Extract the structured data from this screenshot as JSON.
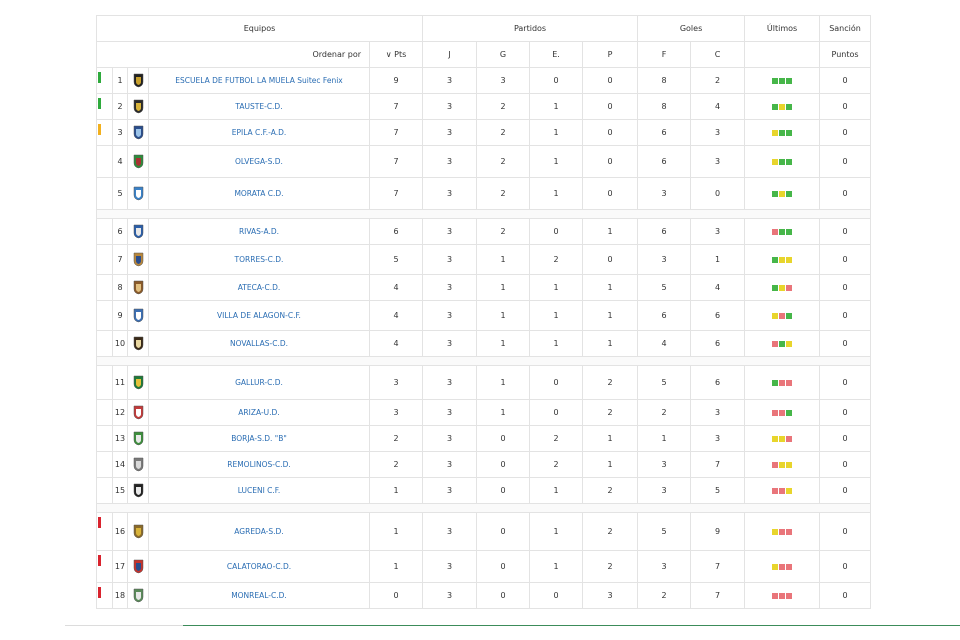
{
  "headers": {
    "equipos": "Equipos",
    "partidos": "Partidos",
    "goles": "Goles",
    "ultimos": "Últimos",
    "sancion": "Sanción",
    "ordenar": "Ordenar por",
    "pts": "Pts",
    "j": "J",
    "g": "G",
    "e": "E.",
    "p": "P",
    "f": "F",
    "c": "C",
    "puntos": "Puntos"
  },
  "colors": {
    "green": "#2eaa3c",
    "yellow": "#f2b01e",
    "red": "#d9232e",
    "win": "#46b649",
    "draw": "#e8d52c",
    "loss": "#e9757a"
  },
  "teams": [
    {
      "pos": "1",
      "name": "ESCUELA DE FUTBOL LA MUELA Suitec Fenix",
      "pts": "9",
      "j": "3",
      "g": "3",
      "e": "0",
      "p": "0",
      "f": "8",
      "c": "2",
      "san": "0",
      "mark": "green",
      "last": [
        "W",
        "W",
        "W"
      ]
    },
    {
      "pos": "2",
      "name": "TAUSTE-C.D.",
      "pts": "7",
      "j": "3",
      "g": "2",
      "e": "1",
      "p": "0",
      "f": "8",
      "c": "4",
      "san": "0",
      "mark": "green",
      "last": [
        "W",
        "D",
        "W"
      ]
    },
    {
      "pos": "3",
      "name": "EPILA C.F.-A.D.",
      "pts": "7",
      "j": "3",
      "g": "2",
      "e": "1",
      "p": "0",
      "f": "6",
      "c": "3",
      "san": "0",
      "mark": "yellow",
      "last": [
        "D",
        "W",
        "W"
      ]
    },
    {
      "pos": "4",
      "name": "OLVEGA-S.D.",
      "pts": "7",
      "j": "3",
      "g": "2",
      "e": "1",
      "p": "0",
      "f": "6",
      "c": "3",
      "san": "0",
      "mark": "",
      "last": [
        "D",
        "W",
        "W"
      ]
    },
    {
      "pos": "5",
      "name": "MORATA C.D.",
      "pts": "7",
      "j": "3",
      "g": "2",
      "e": "1",
      "p": "0",
      "f": "3",
      "c": "0",
      "san": "0",
      "mark": "",
      "last": [
        "W",
        "D",
        "W"
      ]
    },
    {
      "pos": "6",
      "name": "RIVAS-A.D.",
      "pts": "6",
      "j": "3",
      "g": "2",
      "e": "0",
      "p": "1",
      "f": "6",
      "c": "3",
      "san": "0",
      "mark": "",
      "last": [
        "L",
        "W",
        "W"
      ]
    },
    {
      "pos": "7",
      "name": "TORRES-C.D.",
      "pts": "5",
      "j": "3",
      "g": "1",
      "e": "2",
      "p": "0",
      "f": "3",
      "c": "1",
      "san": "0",
      "mark": "",
      "last": [
        "W",
        "D",
        "D"
      ]
    },
    {
      "pos": "8",
      "name": "ATECA-C.D.",
      "pts": "4",
      "j": "3",
      "g": "1",
      "e": "1",
      "p": "1",
      "f": "5",
      "c": "4",
      "san": "0",
      "mark": "",
      "last": [
        "W",
        "D",
        "L"
      ]
    },
    {
      "pos": "9",
      "name": "VILLA DE ALAGON-C.F.",
      "pts": "4",
      "j": "3",
      "g": "1",
      "e": "1",
      "p": "1",
      "f": "6",
      "c": "6",
      "san": "0",
      "mark": "",
      "last": [
        "D",
        "L",
        "W"
      ]
    },
    {
      "pos": "10",
      "name": "NOVALLAS-C.D.",
      "pts": "4",
      "j": "3",
      "g": "1",
      "e": "1",
      "p": "1",
      "f": "4",
      "c": "6",
      "san": "0",
      "mark": "",
      "last": [
        "L",
        "W",
        "D"
      ]
    },
    {
      "pos": "11",
      "name": "GALLUR-C.D.",
      "pts": "3",
      "j": "3",
      "g": "1",
      "e": "0",
      "p": "2",
      "f": "5",
      "c": "6",
      "san": "0",
      "mark": "",
      "last": [
        "W",
        "L",
        "L"
      ]
    },
    {
      "pos": "12",
      "name": "ARIZA-U.D.",
      "pts": "3",
      "j": "3",
      "g": "1",
      "e": "0",
      "p": "2",
      "f": "2",
      "c": "3",
      "san": "0",
      "mark": "",
      "last": [
        "L",
        "L",
        "W"
      ]
    },
    {
      "pos": "13",
      "name": "BORJA-S.D. \"B\"",
      "pts": "2",
      "j": "3",
      "g": "0",
      "e": "2",
      "p": "1",
      "f": "1",
      "c": "3",
      "san": "0",
      "mark": "",
      "last": [
        "D",
        "D",
        "L"
      ]
    },
    {
      "pos": "14",
      "name": "REMOLINOS-C.D.",
      "pts": "2",
      "j": "3",
      "g": "0",
      "e": "2",
      "p": "1",
      "f": "3",
      "c": "7",
      "san": "0",
      "mark": "",
      "last": [
        "L",
        "D",
        "D"
      ]
    },
    {
      "pos": "15",
      "name": "LUCENI C.F.",
      "pts": "1",
      "j": "3",
      "g": "0",
      "e": "1",
      "p": "2",
      "f": "3",
      "c": "5",
      "san": "0",
      "mark": "",
      "last": [
        "L",
        "L",
        "D"
      ]
    },
    {
      "pos": "16",
      "name": "AGREDA-S.D.",
      "pts": "1",
      "j": "3",
      "g": "0",
      "e": "1",
      "p": "2",
      "f": "5",
      "c": "9",
      "san": "0",
      "mark": "red",
      "last": [
        "D",
        "L",
        "L"
      ]
    },
    {
      "pos": "17",
      "name": "CALATORAO-C.D.",
      "pts": "1",
      "j": "3",
      "g": "0",
      "e": "1",
      "p": "2",
      "f": "3",
      "c": "7",
      "san": "0",
      "mark": "red",
      "last": [
        "D",
        "L",
        "L"
      ]
    },
    {
      "pos": "18",
      "name": "MONREAL-C.D.",
      "pts": "0",
      "j": "3",
      "g": "0",
      "e": "0",
      "p": "3",
      "f": "2",
      "c": "7",
      "san": "0",
      "mark": "red",
      "last": [
        "L",
        "L",
        "L"
      ]
    }
  ]
}
